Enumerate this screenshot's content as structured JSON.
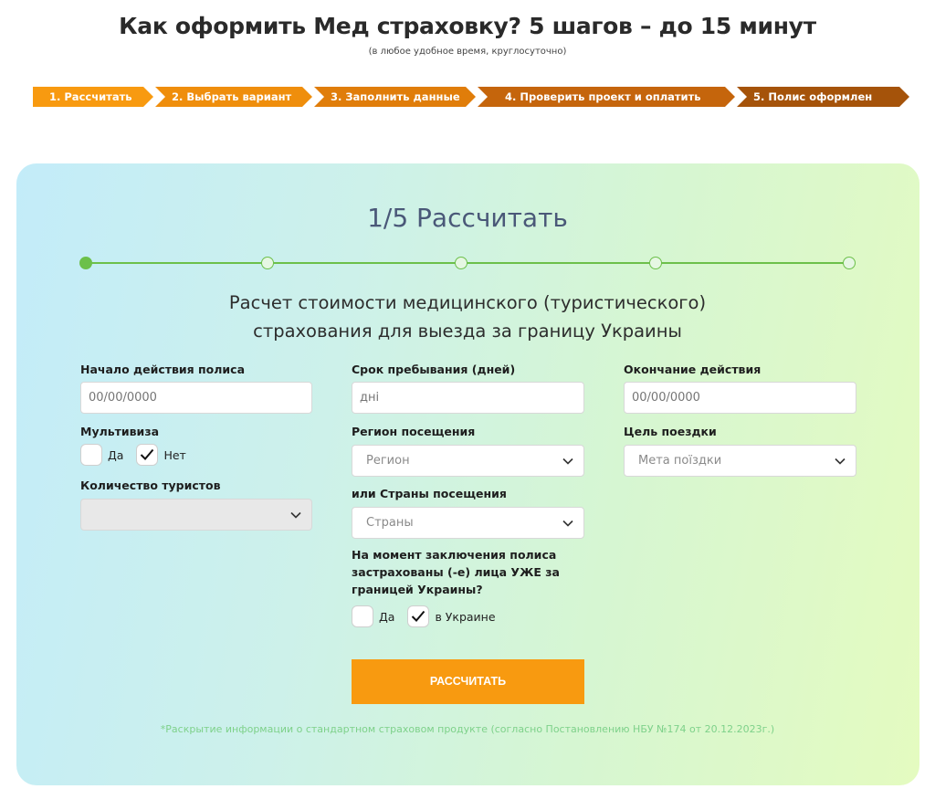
{
  "header": {
    "title": "Как оформить Мед страховку? 5 шагов – до 15 минут",
    "subtitle": "(в любое удобное время, круглосуточно)"
  },
  "steps": [
    {
      "label": "1. Рассчитать",
      "color": "#f89a10"
    },
    {
      "label": "2. Выбрать вариант",
      "color": "#ef8e0c"
    },
    {
      "label": "3. Заполнить данные",
      "color": "#e07d0a"
    },
    {
      "label": "4. Проверить проект и оплатить",
      "color": "#c5650c"
    },
    {
      "label": "5. Полис оформлен",
      "color": "#a5530a"
    }
  ],
  "card": {
    "title": "1/5 Рассчитать",
    "progress_current": 1,
    "progress_total": 5,
    "section_title_line1": "Расчет стоимости медицинского (туристического)",
    "section_title_line2": "страхования для выезда за границу Украины"
  },
  "form": {
    "start_date": {
      "label": "Начало действия полиса",
      "placeholder": "00/00/0000"
    },
    "multivisa": {
      "label": "Мультивиза",
      "yes_label": "Да",
      "no_label": "Нет",
      "yes_checked": false,
      "no_checked": true
    },
    "tourists_count": {
      "label": "Количество туристов",
      "value": ""
    },
    "stay_days": {
      "label": "Срок пребывания (дней)",
      "placeholder": "дні"
    },
    "region": {
      "label": "Регион посещения",
      "value": "Регион"
    },
    "countries": {
      "label": "или Страны посещения",
      "value": "Страны"
    },
    "abroad_question": {
      "label_line1": "На момент заключения полиса",
      "label_line2": "застрахованы (-е) лица УЖЕ за",
      "label_line3": "границей Украины?",
      "yes_label": "Да",
      "no_label": "в Украине",
      "yes_checked": false,
      "no_checked": true
    },
    "end_date": {
      "label": "Окончание действия",
      "placeholder": "00/00/0000"
    },
    "trip_purpose": {
      "label": "Цель поездки",
      "value": "Мета поїздки"
    }
  },
  "actions": {
    "calculate_label": "РАССЧИТАТЬ"
  },
  "footer": {
    "disclosure": "*Раскрытие информации о стандартном страховом продукте (согласно Постановлению НБУ №174 от 20.12.2023г.)"
  },
  "colors": {
    "accent_orange": "#f89a10",
    "progress_green": "#6cc04a",
    "disclosure_green": "#7ed18a"
  }
}
